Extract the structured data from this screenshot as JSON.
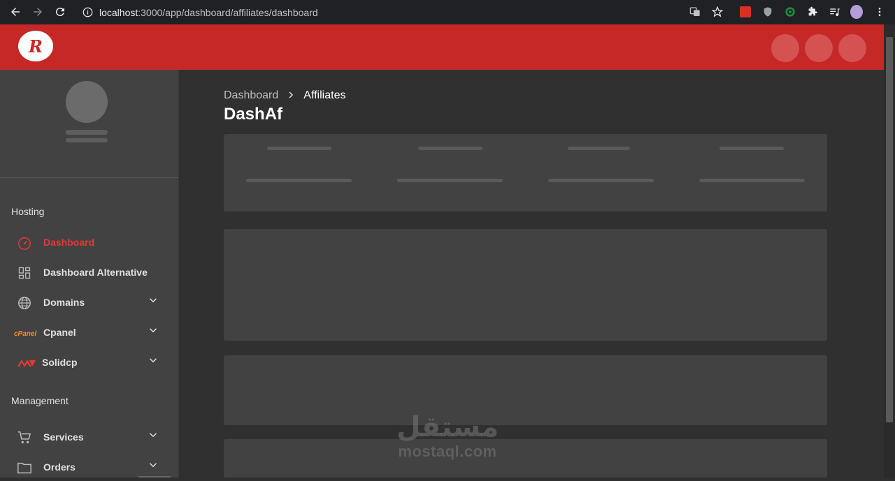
{
  "browser": {
    "url_host": "localhost",
    "url_rest": ":3000/app/dashboard/affiliates/dashboard"
  },
  "app": {
    "logo_letter": "R",
    "accent": "#c62828"
  },
  "sidebar": {
    "sections": [
      {
        "title": "Hosting",
        "items": [
          {
            "label": "Dashboard",
            "icon": "speedometer-icon",
            "active": true
          },
          {
            "label": "Dashboard Alternative",
            "icon": "grid-icon"
          },
          {
            "label": "Domains",
            "icon": "globe-icon",
            "expandable": true
          },
          {
            "label": "Cpanel",
            "icon": "cpanel-logo-icon",
            "expandable": true
          },
          {
            "label": "Solidcp",
            "icon": "solidcp-logo-icon",
            "expandable": true
          }
        ]
      },
      {
        "title": "Management",
        "items": [
          {
            "label": "Services",
            "icon": "cart-icon",
            "expandable": true
          },
          {
            "label": "Orders",
            "icon": "folder-icon",
            "expandable": true
          }
        ]
      }
    ]
  },
  "main": {
    "breadcrumb": [
      "Dashboard",
      "Affiliates"
    ],
    "title": "DashAf"
  },
  "watermark": {
    "arabic": "مستقل",
    "latin": "mostaql.com"
  }
}
